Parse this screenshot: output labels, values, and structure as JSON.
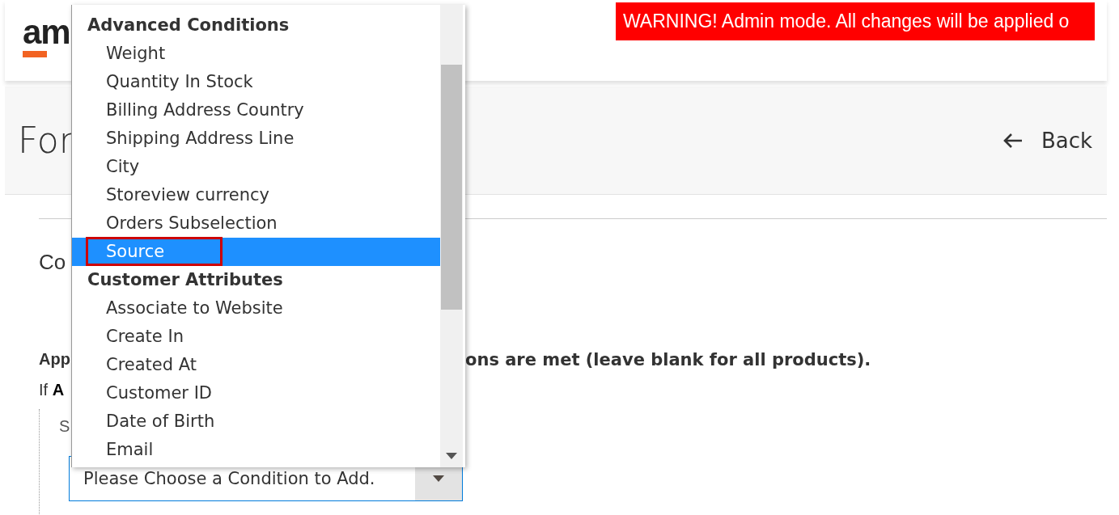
{
  "header": {
    "logo": "am",
    "warning": "WARNING! Admin mode. All changes will be applied o"
  },
  "page": {
    "title": "For",
    "back": "Back"
  },
  "section": {
    "title": "Co"
  },
  "conditions": {
    "intro_start": "App",
    "intro_end": "ons are met (leave blank for all products).",
    "if_line": "If **A**",
    "sub_label": "S",
    "select": {
      "value": "Please Choose a Condition to Add."
    }
  },
  "dropdown": {
    "groups": [
      {
        "label": "Advanced Conditions",
        "options": [
          {
            "label": "Weight",
            "selected": false,
            "outlined": false
          },
          {
            "label": "Quantity In Stock",
            "selected": false,
            "outlined": false
          },
          {
            "label": "Billing Address Country",
            "selected": false,
            "outlined": false
          },
          {
            "label": "Shipping Address Line",
            "selected": false,
            "outlined": false
          },
          {
            "label": "City",
            "selected": false,
            "outlined": false
          },
          {
            "label": "Storeview currency",
            "selected": false,
            "outlined": false
          },
          {
            "label": "Orders Subselection",
            "selected": false,
            "outlined": false
          },
          {
            "label": "Source",
            "selected": true,
            "outlined": true
          }
        ]
      },
      {
        "label": "Customer Attributes",
        "options": [
          {
            "label": "Associate to Website",
            "selected": false,
            "outlined": false
          },
          {
            "label": "Create In",
            "selected": false,
            "outlined": false
          },
          {
            "label": "Created At",
            "selected": false,
            "outlined": false
          },
          {
            "label": "Customer ID",
            "selected": false,
            "outlined": false
          },
          {
            "label": "Date of Birth",
            "selected": false,
            "outlined": false
          },
          {
            "label": "Email",
            "selected": false,
            "outlined": false
          }
        ]
      }
    ]
  }
}
